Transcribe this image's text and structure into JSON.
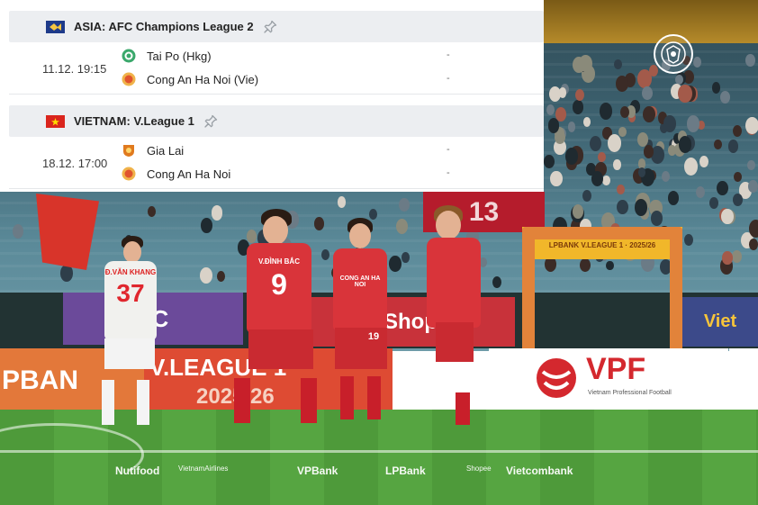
{
  "fixtures": {
    "leagues": [
      {
        "title": "ASIA: AFC Champions League 2",
        "matches": [
          {
            "time": "11.12. 19:15",
            "home": "Tai Po (Hkg)",
            "away": "Cong An Ha Noi (Vie)",
            "home_score": "-",
            "away_score": "-"
          }
        ]
      },
      {
        "title": "VIETNAM: V.League 1",
        "matches": [
          {
            "time": "18.12. 17:00",
            "home": "Gia Lai",
            "away": "Cong An Ha Noi",
            "home_score": "-",
            "away_score": "-"
          }
        ]
      }
    ]
  },
  "photo": {
    "stand_number": "13",
    "gate_banner": "LPBANK V.LEAGUE 1 · 2025/26",
    "boards": {
      "shop": "Shop",
      "lpbank": "PBAN",
      "vleague": "V.LEAGUE 1",
      "season": "2025/26",
      "vpf": "VPF",
      "vpf_sub": "Vietnam Professional Football",
      "vietnam": "Viet",
      "tc": "TC"
    },
    "players": {
      "p1_name": "Đ.VĂN KHANG",
      "p1_number": "37",
      "p2_name": "V.ĐÌNH BẮC",
      "p2_number": "9",
      "p3_sponsor": "CONG AN HA NOI",
      "p3_number": "19"
    },
    "sponsors": [
      "Nutifood",
      "VietnamAirlines",
      "VPBank",
      "LPBank",
      "Shopee",
      "Vietcombank"
    ]
  },
  "colors": {
    "header_bg": "#eceef1",
    "divider": "#e5e7ea",
    "team_red": "#d9343a",
    "afc_blue": "#1e3a8a",
    "vietnam_red": "#da251d"
  },
  "icons": {
    "pin": "pin-icon",
    "afc_flag": "asia-flag-icon",
    "vn_flag": "vietnam-flag-icon"
  }
}
